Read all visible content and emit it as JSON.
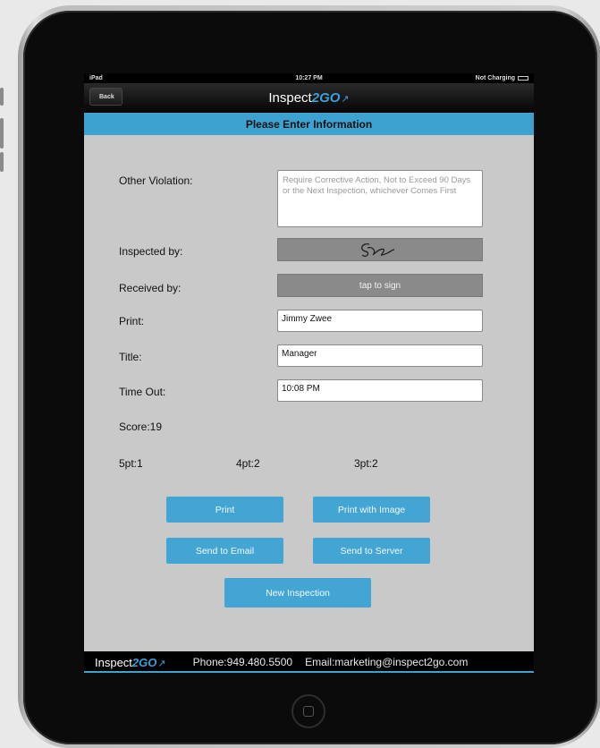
{
  "status_bar": {
    "device": "iPad",
    "time": "10:27 PM",
    "battery": "Not Charging"
  },
  "nav": {
    "back_label": "Back",
    "brand_prefix": "Inspect",
    "brand_accent": "2GO"
  },
  "header": {
    "title": "Please Enter Information"
  },
  "form": {
    "other_violation_label": "Other Violation:",
    "other_violation_placeholder": "Require Corrective Action, Not to Exceed 90 Days or the Next Inspection, whichever Comes First",
    "inspected_by_label": "Inspected by:",
    "received_by_label": "Received by:",
    "received_by_action": "tap to sign",
    "print_label": "Print:",
    "print_value": "Jimmy Zwee",
    "title_label": "Title:",
    "title_value": "Manager",
    "time_out_label": "Time Out:",
    "time_out_value": "10:08 PM"
  },
  "results": {
    "score": "Score:19",
    "pt5": "5pt:1",
    "pt4": "4pt:2",
    "pt3": "3pt:2"
  },
  "buttons": {
    "print": "Print",
    "print_with_image": "Print  with Image",
    "send_to_email": "Send to Email",
    "send_to_server": "Send to Server",
    "new_inspection": "New Inspection"
  },
  "footer": {
    "brand_prefix": "Inspect",
    "brand_accent": "2GO",
    "phone": "Phone:949.480.5500",
    "email": "Email:marketing@inspect2go.com"
  },
  "colors": {
    "accent": "#3ea2d1",
    "screen_bg": "#c9c9c9",
    "signature_bg": "#8a8a8a"
  }
}
